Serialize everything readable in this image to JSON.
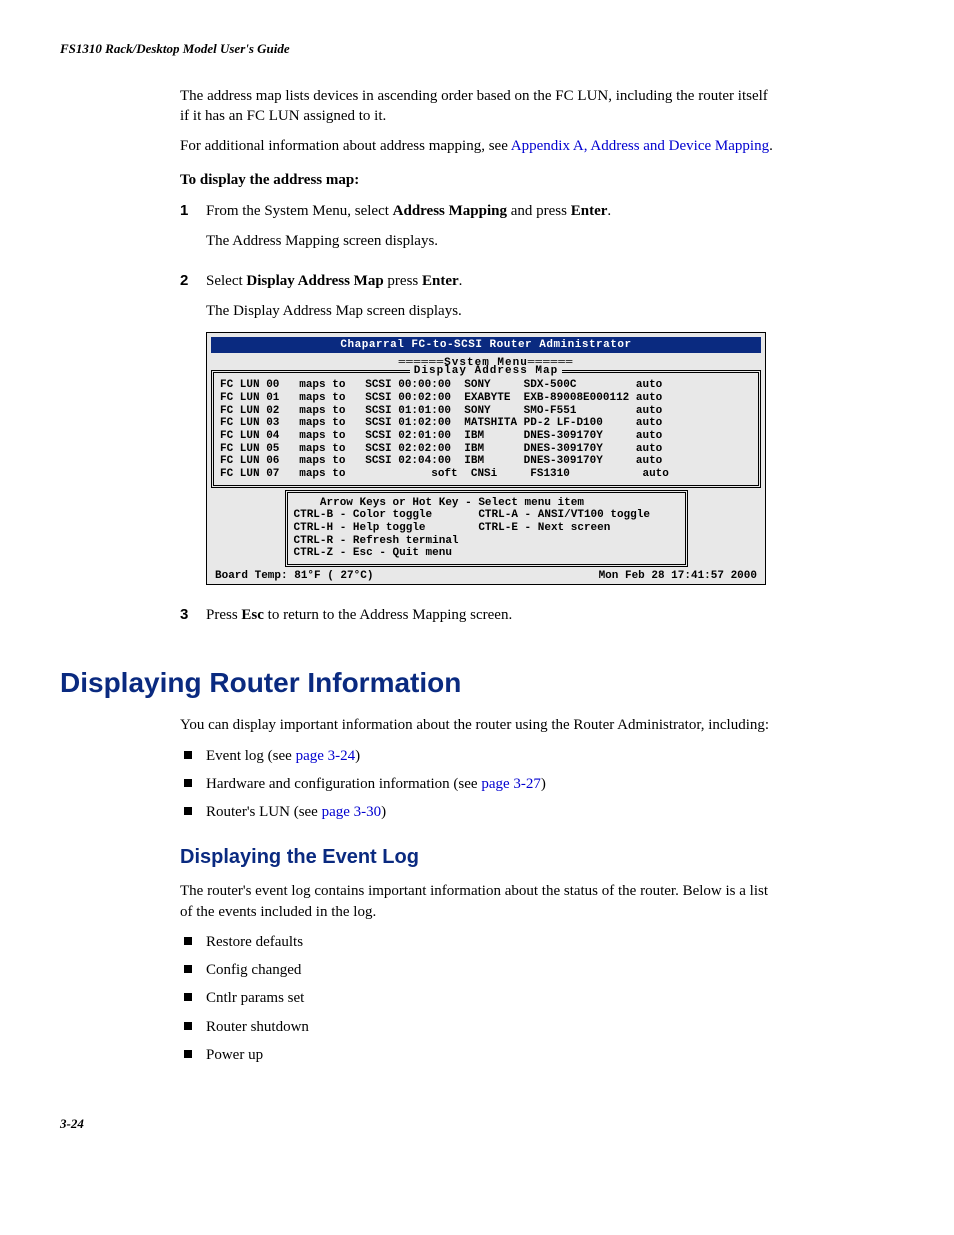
{
  "running_head": "FS1310 Rack/Desktop Model User's Guide",
  "intro_p1_pre": "The address map lists devices in ascending order based on the FC LUN, including the router itself if it has an FC LUN assigned to it.",
  "intro_p2_pre": "For additional information about address mapping, see ",
  "intro_p2_link": "Appendix A, Address and Device Mapping",
  "intro_p2_post": ".",
  "subhead_display": "To display the address map:",
  "step1_num": "1",
  "step1_line_a": "From the System Menu, select ",
  "step1_bold_a": "Address Mapping",
  "step1_line_b": " and press ",
  "step1_bold_b": "Enter",
  "step1_line_c": ".",
  "step1_p2": "The Address Mapping screen displays.",
  "step2_num": "2",
  "step2_line_a": "Select ",
  "step2_bold_a": "Display Address Map",
  "step2_line_b": " press ",
  "step2_bold_b": "Enter",
  "step2_line_c": ".",
  "step2_p2": "The Display Address Map screen displays.",
  "terminal": {
    "title": "Chaparral FC-to-SCSI Router Administrator",
    "sysmenu": "══════System Menu══════",
    "body_title": "Display Address Map",
    "rows": [
      "FC LUN 00   maps to   SCSI 00:00:00  SONY     SDX-500C         auto",
      "FC LUN 01   maps to   SCSI 00:02:00  EXABYTE  EXB-89008E000112 auto",
      "FC LUN 02   maps to   SCSI 01:01:00  SONY     SMO-F551         auto",
      "FC LUN 03   maps to   SCSI 01:02:00  MATSHITA PD-2 LF-D100     auto",
      "FC LUN 04   maps to   SCSI 02:01:00  IBM      DNES-309170Y     auto",
      "FC LUN 05   maps to   SCSI 02:02:00  IBM      DNES-309170Y     auto",
      "FC LUN 06   maps to   SCSI 02:04:00  IBM      DNES-309170Y     auto",
      "FC LUN 07   maps to             soft  CNSi     FS1310           auto"
    ],
    "help": "    Arrow Keys or Hot Key - Select menu item\nCTRL-B - Color toggle       CTRL-A - ANSI/VT100 toggle\nCTRL-H - Help toggle        CTRL-E - Next screen\nCTRL-R - Refresh terminal\nCTRL-Z - Esc - Quit menu",
    "status_left": "Board Temp:  81°F ( 27°C)",
    "status_right": "Mon Feb 28 17:41:57 2000"
  },
  "step3_num": "3",
  "step3_line_a": "Press ",
  "step3_bold_a": "Esc",
  "step3_line_b": " to return to the Address Mapping screen.",
  "h1": "Displaying Router Information",
  "router_info_p": "You can display important information about the router using the Router Administrator, including:",
  "router_info_items": [
    {
      "pre": "Event log (see ",
      "link": "page 3-24",
      "post": ")"
    },
    {
      "pre": "Hardware and configuration information (see ",
      "link": "page 3-27",
      "post": ")"
    },
    {
      "pre": "Router's LUN (see ",
      "link": "page 3-30",
      "post": ")"
    }
  ],
  "h2": "Displaying the Event Log",
  "eventlog_p": "The router's event log contains important information about the status of the router. Below is a list of the events included in the log.",
  "eventlog_items": [
    "Restore defaults",
    "Config changed",
    "Cntlr params set",
    "Router shutdown",
    "Power up"
  ],
  "page_footer": "3-24"
}
